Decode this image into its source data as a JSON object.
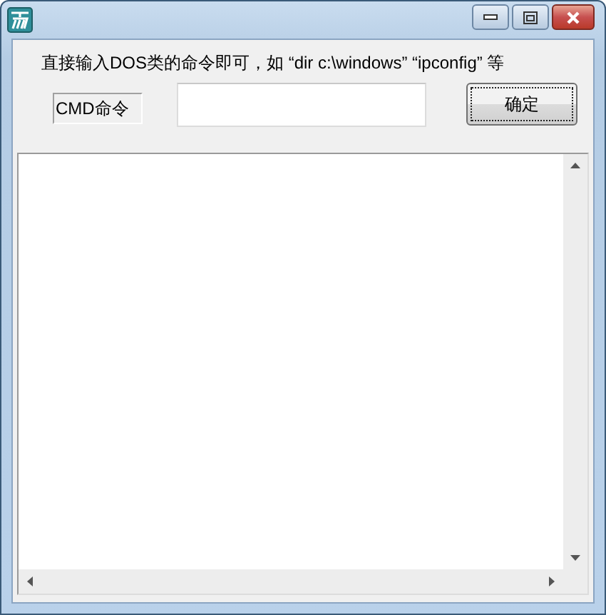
{
  "instruction": "直接输入DOS类的命令即可，如 “dir c:\\windows” “ipconfig” 等",
  "command_label": "CMD命令",
  "submit_button": "确定"
}
